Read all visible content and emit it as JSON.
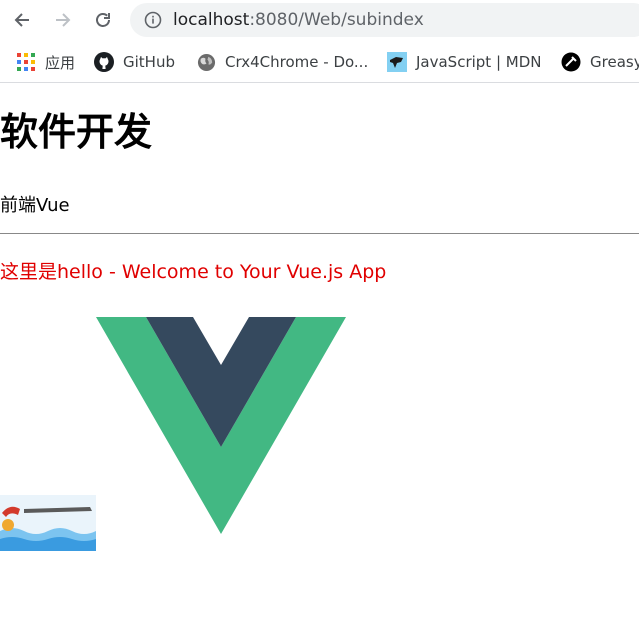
{
  "browser": {
    "url_host": "localhost",
    "url_path": ":8080/Web/subindex"
  },
  "bookmarks": [
    {
      "label": "应用",
      "icon": "apps-grid-icon"
    },
    {
      "label": "GitHub",
      "icon": "github-icon"
    },
    {
      "label": "Crx4Chrome - Do...",
      "icon": "globe-icon"
    },
    {
      "label": "JavaScript | MDN",
      "icon": "mdn-icon"
    },
    {
      "label": "Greasy",
      "icon": "greasyfork-icon"
    }
  ],
  "page": {
    "title": "软件开发",
    "subtitle": "前端Vue",
    "hello_text": "这里是hello - Welcome to Your Vue.js App"
  },
  "colors": {
    "vue_green": "#42b883",
    "vue_dark": "#35495e",
    "hello_red": "#e00000"
  }
}
